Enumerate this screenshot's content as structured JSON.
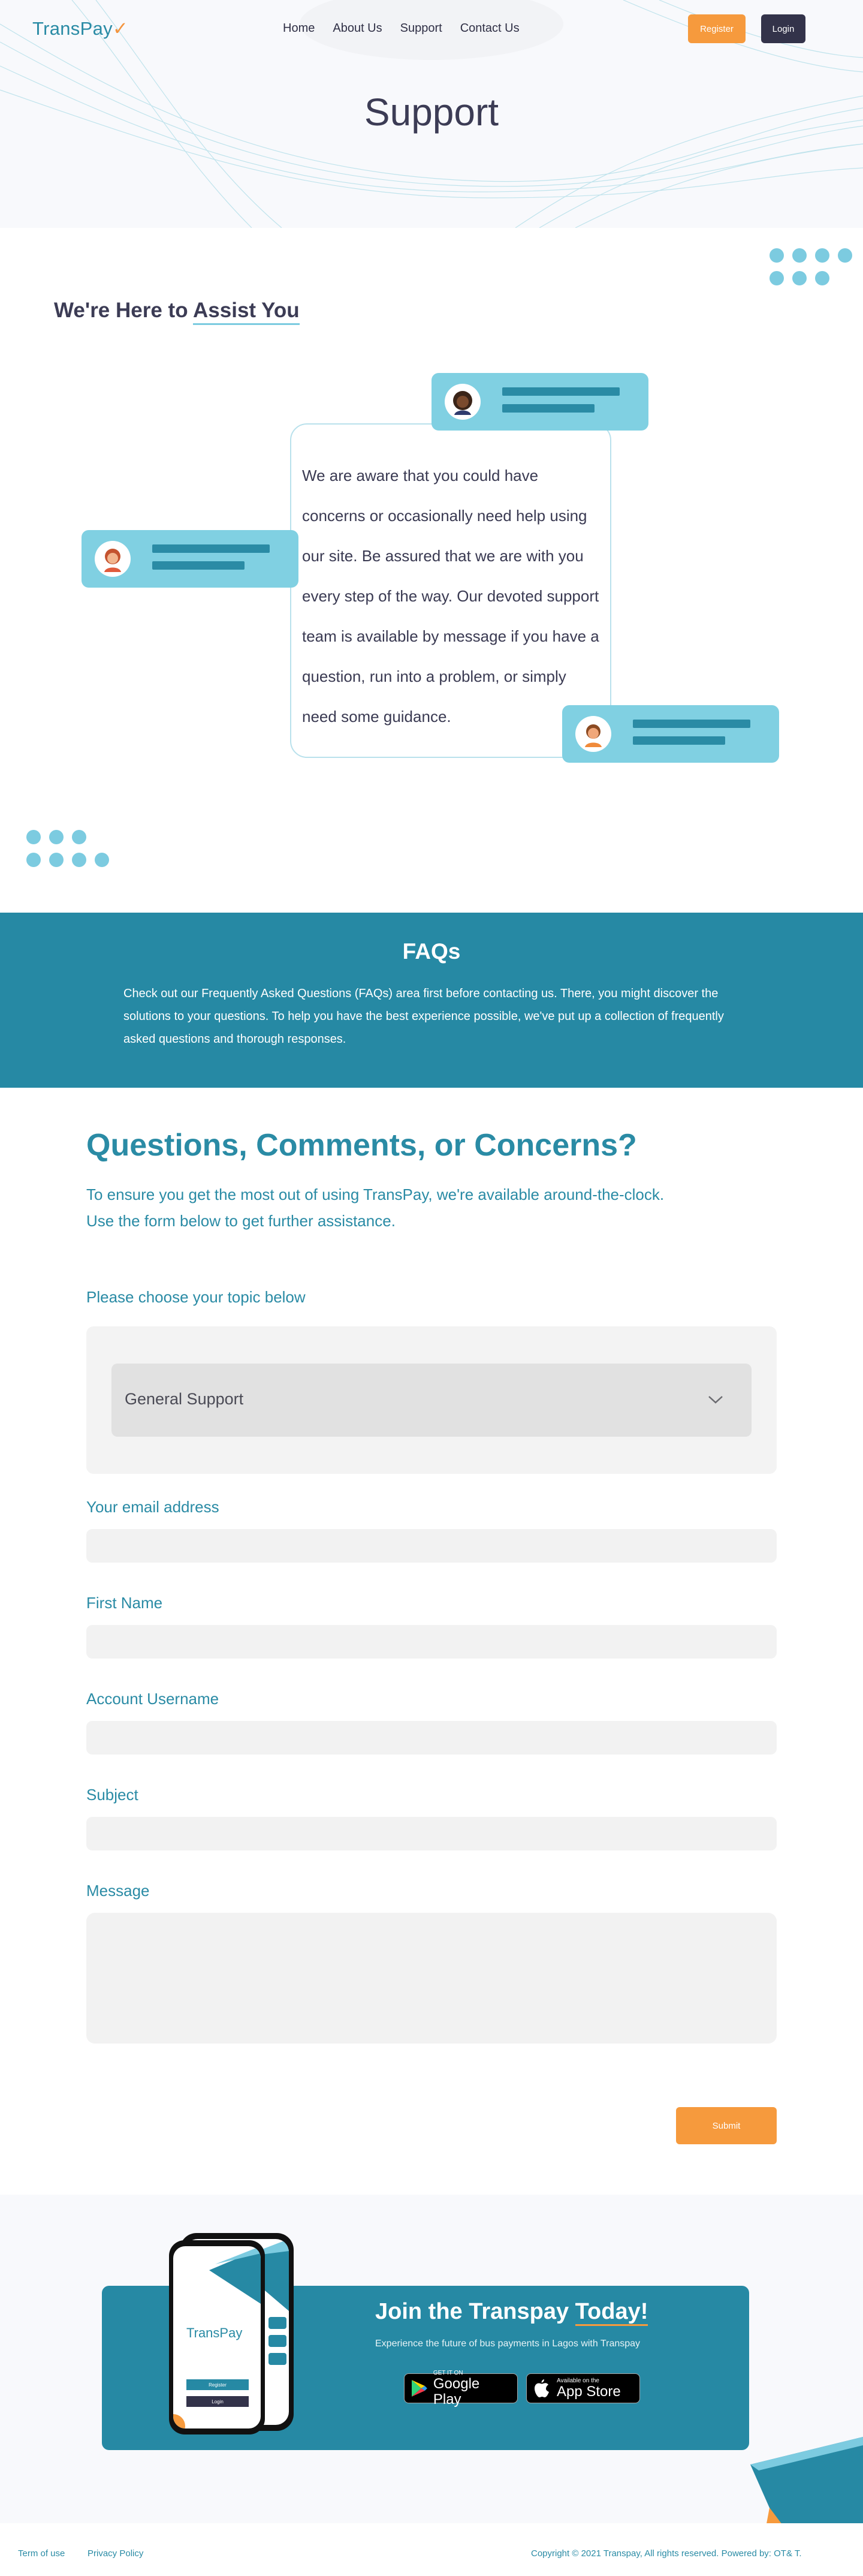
{
  "header": {
    "logo_text": "TransPay",
    "nav": [
      "Home",
      "About Us",
      "Support",
      "Contact Us"
    ],
    "register_label": "Register",
    "login_label": "Login"
  },
  "hero": {
    "title": "Support"
  },
  "assist": {
    "title_prefix": "We're Here to ",
    "title_highlight": "Assist You",
    "body": "We are aware that you could have concerns or occasionally need help using our site. Be assured that we are with you every step of the way. Our devoted support team is available by message if you have a question, run into a problem, or simply need some guidance."
  },
  "faq": {
    "title": "FAQs",
    "body": "Check out our Frequently Asked Questions (FAQs) area first before contacting us. There, you might discover the solutions to your questions. To help you have the best experience possible, we've put up a collection of frequently asked questions and thorough responses."
  },
  "form": {
    "title": "Questions, Comments, or Concerns?",
    "subtitle_line1": "To ensure you get the most out of using TransPay, we're available around-the-clock.",
    "subtitle_line2": "Use the form below to get further assistance.",
    "topic_label": "Please choose your topic below",
    "topic_value": "General Support",
    "email_label": "Your email address",
    "first_name_label": "First Name",
    "username_label": "Account Username",
    "subject_label": "Subject",
    "message_label": "Message",
    "submit_label": "Submit"
  },
  "cta": {
    "title_prefix": "Join the Transpay ",
    "title_highlight": "Today!",
    "subtitle": "Experience the future of bus payments in Lagos with Transpay",
    "google_small": "GET IT ON",
    "google_big": "Google Play",
    "apple_small": "Available on the",
    "apple_big": "App Store",
    "phone_logo": "TransPay",
    "phone_register": "Register",
    "phone_login": "Login"
  },
  "footer": {
    "terms": "Term of use",
    "privacy": "Privacy Policy",
    "copyright": "Copyright © 2021 Transpay, All rights reserved. Powered by: OT& T."
  },
  "colors": {
    "brand": "#2a8ba5",
    "accent": "#f69a3d",
    "dark": "#33334a",
    "light_blue": "#80d0e2"
  }
}
